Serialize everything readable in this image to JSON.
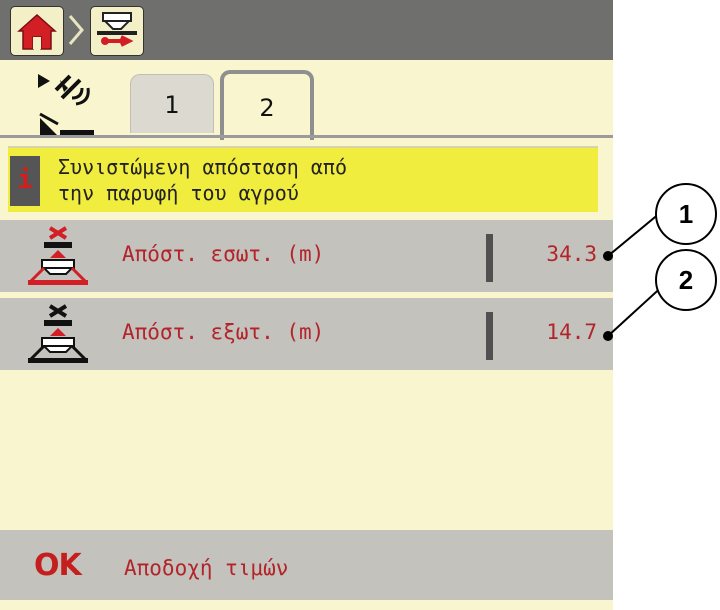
{
  "header": {
    "home_icon": "home-icon",
    "breadcrumb_icon": "spreader-settings-icon"
  },
  "tabs": {
    "side_icons": [
      "gps-control-icon",
      "boundary-spreading-icon"
    ],
    "items": [
      {
        "label": "1",
        "active": false
      },
      {
        "label": "2",
        "active": true
      }
    ]
  },
  "info": {
    "icon": "i",
    "line1": "Συνιστώμενη απόσταση από",
    "line2": "την παρυφή του αγρού"
  },
  "rows": [
    {
      "label": "Απόστ. εσωτ. (m)",
      "value": "34.3",
      "icon": "inner-distance-spreader-icon"
    },
    {
      "label": "Απόστ. εξωτ. (m)",
      "value": "14.7",
      "icon": "outer-distance-spreader-icon"
    }
  ],
  "footer": {
    "ok_symbol": "OK",
    "ok_label": "Αποδοχή τιμών"
  },
  "callouts": [
    "1",
    "2"
  ],
  "colors": {
    "background": "#f8f5cf",
    "header": "#6f6f6d",
    "info_bar": "#f0ed3f",
    "row": "#c3c2bd",
    "text_red": "#b3242a"
  }
}
